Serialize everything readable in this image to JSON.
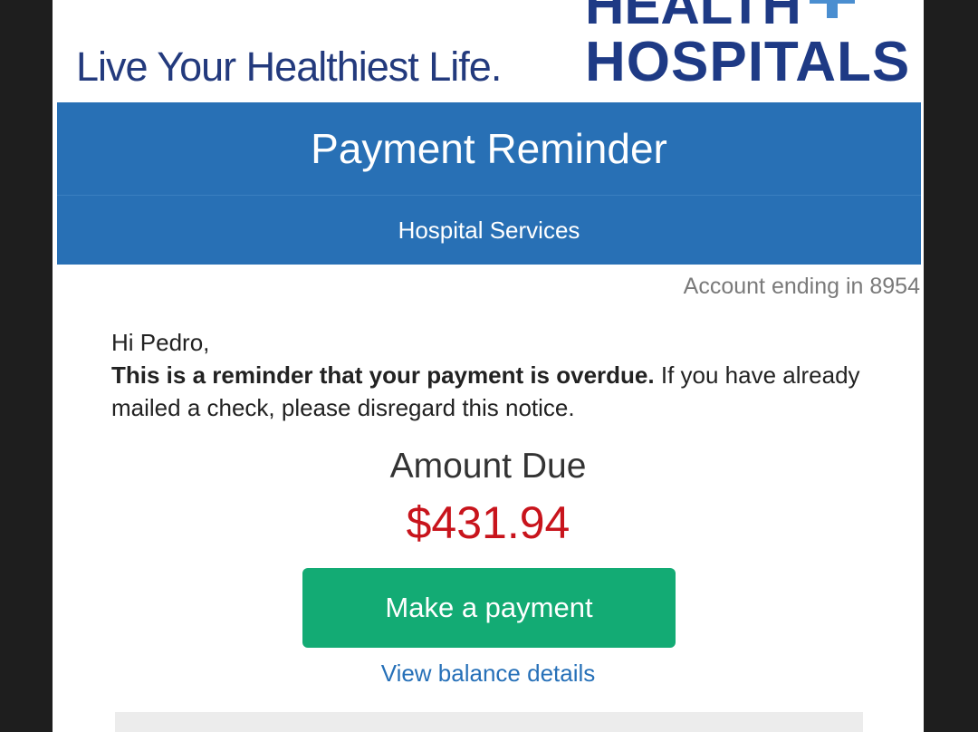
{
  "header": {
    "tagline": "Live Your Healthiest Life.",
    "logo_line1": "HEALTH",
    "logo_line2": "HOSPITALS"
  },
  "banner": {
    "title": "Payment Reminder",
    "subtitle": "Hospital Services"
  },
  "account": {
    "text": "Account ending in 8954"
  },
  "message": {
    "greeting": "Hi Pedro,",
    "bold_text": "This is a reminder that your payment is overdue.",
    "body_text": " If you have already mailed a check, please disregard this notice."
  },
  "amount": {
    "label": "Amount Due",
    "value": "$431.94"
  },
  "actions": {
    "pay_button": "Make a payment",
    "balance_link": "View balance details"
  },
  "colors": {
    "brand_navy": "#1e3a85",
    "brand_light_blue": "#4a8ed0",
    "banner_blue": "#2870b5",
    "amount_red": "#c8141c",
    "button_green": "#13ab74",
    "link_blue": "#2670b8"
  }
}
